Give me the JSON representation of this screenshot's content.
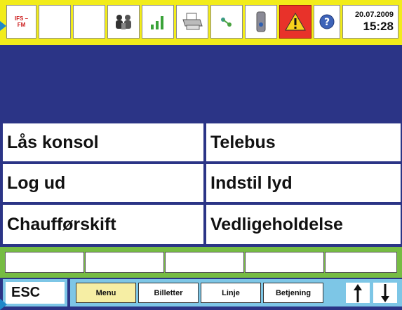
{
  "status_bar": {
    "ifs_label_line1": "IFS –",
    "ifs_label_line2": "FM",
    "icons": [
      "people-icon",
      "signal-icon",
      "printer-icon",
      "network-icon",
      "device-icon",
      "warning-icon",
      "help-icon"
    ],
    "date": "20.07.2009",
    "time": "15:28",
    "colors": {
      "background": "#f2ec1a",
      "warning": "#e8322a",
      "help": "#3d63b8",
      "signal": "#3aa339"
    }
  },
  "menu": {
    "items": [
      {
        "label": "Lås konsol"
      },
      {
        "label": "Telebus"
      },
      {
        "label": "Log ud"
      },
      {
        "label": "Indstil lyd"
      },
      {
        "label": "Chaufførskift"
      },
      {
        "label": "Vedligeholdelse"
      }
    ]
  },
  "bottom_bar": {
    "esc_label": "ESC",
    "tabs": [
      {
        "label": "Menu",
        "active": true
      },
      {
        "label": "Billetter",
        "active": false
      },
      {
        "label": "Linje",
        "active": false
      },
      {
        "label": "Betjening",
        "active": false
      }
    ],
    "up_arrow_icon": "arrow-up-icon",
    "down_arrow_icon": "arrow-down-icon"
  },
  "colors": {
    "primary_blue": "#2b3486",
    "green": "#76bc43",
    "light_blue": "#7dc6e6",
    "tab_active": "#f6eea4"
  }
}
